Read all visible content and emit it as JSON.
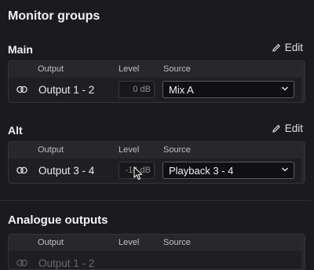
{
  "title": "Monitor groups",
  "edit_label": "Edit",
  "columns": {
    "output": "Output",
    "level": "Level",
    "source": "Source"
  },
  "groups": [
    {
      "name": "Main",
      "output": "Output 1 - 2",
      "level": "0 dB",
      "source": "Mix A"
    },
    {
      "name": "Alt",
      "output": "Output 3 - 4",
      "level": "-14 dB",
      "source": "Playback 3 - 4"
    }
  ],
  "analogue": {
    "title": "Analogue outputs",
    "first_output": "Output 1 - 2"
  }
}
